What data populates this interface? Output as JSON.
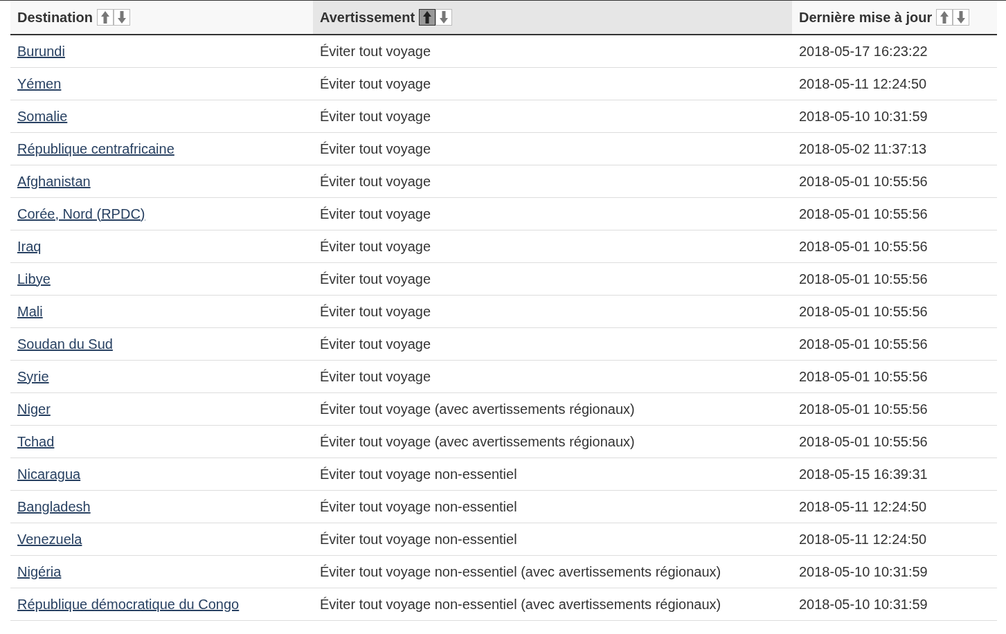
{
  "table": {
    "columns": [
      {
        "label": "Destination",
        "sorted": false,
        "sort_buttons": [
          {
            "kind": "up",
            "selected": false
          },
          {
            "kind": "down",
            "selected": false
          }
        ]
      },
      {
        "label": "Avertissement",
        "sorted": true,
        "sort_buttons": [
          {
            "kind": "up",
            "selected": true
          },
          {
            "kind": "down",
            "selected": false
          }
        ]
      },
      {
        "label": "Dernière mise à jour",
        "sorted": false,
        "sort_buttons": [
          {
            "kind": "up",
            "selected": false
          },
          {
            "kind": "down",
            "selected": false
          }
        ]
      }
    ],
    "rows": [
      {
        "destination": "Burundi",
        "warning": "Éviter tout voyage",
        "updated": "2018-05-17 16:23:22"
      },
      {
        "destination": "Yémen",
        "warning": "Éviter tout voyage",
        "updated": "2018-05-11 12:24:50"
      },
      {
        "destination": "Somalie",
        "warning": "Éviter tout voyage",
        "updated": "2018-05-10 10:31:59"
      },
      {
        "destination": "République centrafricaine",
        "warning": "Éviter tout voyage",
        "updated": "2018-05-02 11:37:13"
      },
      {
        "destination": "Afghanistan",
        "warning": "Éviter tout voyage",
        "updated": "2018-05-01 10:55:56"
      },
      {
        "destination": "Corée, Nord (RPDC)",
        "warning": "Éviter tout voyage",
        "updated": "2018-05-01 10:55:56"
      },
      {
        "destination": "Iraq",
        "warning": "Éviter tout voyage",
        "updated": "2018-05-01 10:55:56"
      },
      {
        "destination": "Libye",
        "warning": "Éviter tout voyage",
        "updated": "2018-05-01 10:55:56"
      },
      {
        "destination": "Mali",
        "warning": "Éviter tout voyage",
        "updated": "2018-05-01 10:55:56"
      },
      {
        "destination": "Soudan du Sud",
        "warning": "Éviter tout voyage",
        "updated": "2018-05-01 10:55:56"
      },
      {
        "destination": "Syrie",
        "warning": "Éviter tout voyage",
        "updated": "2018-05-01 10:55:56"
      },
      {
        "destination": "Niger",
        "warning": "Éviter tout voyage (avec avertissements régionaux)",
        "updated": "2018-05-01 10:55:56"
      },
      {
        "destination": "Tchad",
        "warning": "Éviter tout voyage (avec avertissements régionaux)",
        "updated": "2018-05-01 10:55:56"
      },
      {
        "destination": "Nicaragua",
        "warning": "Éviter tout voyage non-essentiel",
        "updated": "2018-05-15 16:39:31"
      },
      {
        "destination": "Bangladesh",
        "warning": "Éviter tout voyage non-essentiel",
        "updated": "2018-05-11 12:24:50"
      },
      {
        "destination": "Venezuela",
        "warning": "Éviter tout voyage non-essentiel",
        "updated": "2018-05-11 12:24:50"
      },
      {
        "destination": "Nigéria",
        "warning": "Éviter tout voyage non-essentiel (avec avertissements régionaux)",
        "updated": "2018-05-10 10:31:59"
      },
      {
        "destination": "République démocratique du Congo",
        "warning": "Éviter tout voyage non-essentiel (avec avertissements régionaux)",
        "updated": "2018-05-10 10:31:59"
      }
    ]
  }
}
